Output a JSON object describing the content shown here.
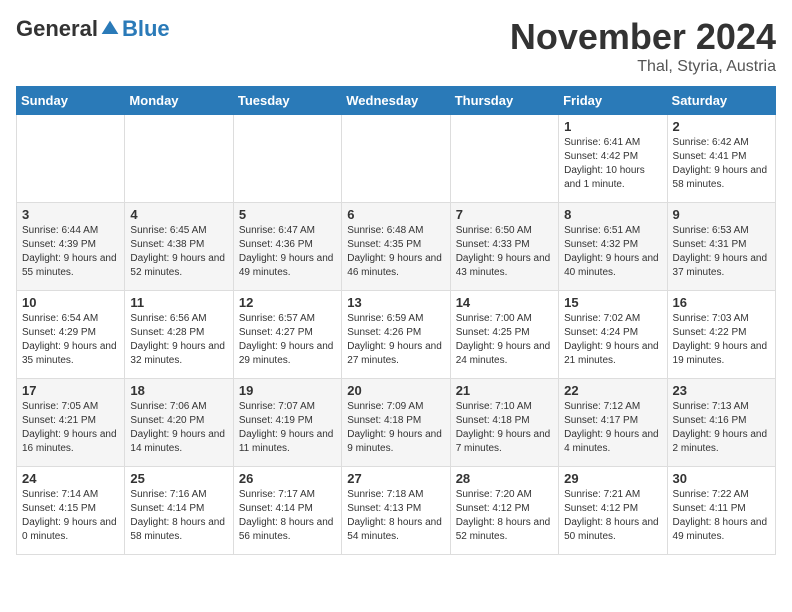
{
  "logo": {
    "general": "General",
    "blue": "Blue"
  },
  "header": {
    "month": "November 2024",
    "location": "Thal, Styria, Austria"
  },
  "weekdays": [
    "Sunday",
    "Monday",
    "Tuesday",
    "Wednesday",
    "Thursday",
    "Friday",
    "Saturday"
  ],
  "weeks": [
    [
      {
        "day": "",
        "info": ""
      },
      {
        "day": "",
        "info": ""
      },
      {
        "day": "",
        "info": ""
      },
      {
        "day": "",
        "info": ""
      },
      {
        "day": "",
        "info": ""
      },
      {
        "day": "1",
        "info": "Sunrise: 6:41 AM\nSunset: 4:42 PM\nDaylight: 10 hours and 1 minute."
      },
      {
        "day": "2",
        "info": "Sunrise: 6:42 AM\nSunset: 4:41 PM\nDaylight: 9 hours and 58 minutes."
      }
    ],
    [
      {
        "day": "3",
        "info": "Sunrise: 6:44 AM\nSunset: 4:39 PM\nDaylight: 9 hours and 55 minutes."
      },
      {
        "day": "4",
        "info": "Sunrise: 6:45 AM\nSunset: 4:38 PM\nDaylight: 9 hours and 52 minutes."
      },
      {
        "day": "5",
        "info": "Sunrise: 6:47 AM\nSunset: 4:36 PM\nDaylight: 9 hours and 49 minutes."
      },
      {
        "day": "6",
        "info": "Sunrise: 6:48 AM\nSunset: 4:35 PM\nDaylight: 9 hours and 46 minutes."
      },
      {
        "day": "7",
        "info": "Sunrise: 6:50 AM\nSunset: 4:33 PM\nDaylight: 9 hours and 43 minutes."
      },
      {
        "day": "8",
        "info": "Sunrise: 6:51 AM\nSunset: 4:32 PM\nDaylight: 9 hours and 40 minutes."
      },
      {
        "day": "9",
        "info": "Sunrise: 6:53 AM\nSunset: 4:31 PM\nDaylight: 9 hours and 37 minutes."
      }
    ],
    [
      {
        "day": "10",
        "info": "Sunrise: 6:54 AM\nSunset: 4:29 PM\nDaylight: 9 hours and 35 minutes."
      },
      {
        "day": "11",
        "info": "Sunrise: 6:56 AM\nSunset: 4:28 PM\nDaylight: 9 hours and 32 minutes."
      },
      {
        "day": "12",
        "info": "Sunrise: 6:57 AM\nSunset: 4:27 PM\nDaylight: 9 hours and 29 minutes."
      },
      {
        "day": "13",
        "info": "Sunrise: 6:59 AM\nSunset: 4:26 PM\nDaylight: 9 hours and 27 minutes."
      },
      {
        "day": "14",
        "info": "Sunrise: 7:00 AM\nSunset: 4:25 PM\nDaylight: 9 hours and 24 minutes."
      },
      {
        "day": "15",
        "info": "Sunrise: 7:02 AM\nSunset: 4:24 PM\nDaylight: 9 hours and 21 minutes."
      },
      {
        "day": "16",
        "info": "Sunrise: 7:03 AM\nSunset: 4:22 PM\nDaylight: 9 hours and 19 minutes."
      }
    ],
    [
      {
        "day": "17",
        "info": "Sunrise: 7:05 AM\nSunset: 4:21 PM\nDaylight: 9 hours and 16 minutes."
      },
      {
        "day": "18",
        "info": "Sunrise: 7:06 AM\nSunset: 4:20 PM\nDaylight: 9 hours and 14 minutes."
      },
      {
        "day": "19",
        "info": "Sunrise: 7:07 AM\nSunset: 4:19 PM\nDaylight: 9 hours and 11 minutes."
      },
      {
        "day": "20",
        "info": "Sunrise: 7:09 AM\nSunset: 4:18 PM\nDaylight: 9 hours and 9 minutes."
      },
      {
        "day": "21",
        "info": "Sunrise: 7:10 AM\nSunset: 4:18 PM\nDaylight: 9 hours and 7 minutes."
      },
      {
        "day": "22",
        "info": "Sunrise: 7:12 AM\nSunset: 4:17 PM\nDaylight: 9 hours and 4 minutes."
      },
      {
        "day": "23",
        "info": "Sunrise: 7:13 AM\nSunset: 4:16 PM\nDaylight: 9 hours and 2 minutes."
      }
    ],
    [
      {
        "day": "24",
        "info": "Sunrise: 7:14 AM\nSunset: 4:15 PM\nDaylight: 9 hours and 0 minutes."
      },
      {
        "day": "25",
        "info": "Sunrise: 7:16 AM\nSunset: 4:14 PM\nDaylight: 8 hours and 58 minutes."
      },
      {
        "day": "26",
        "info": "Sunrise: 7:17 AM\nSunset: 4:14 PM\nDaylight: 8 hours and 56 minutes."
      },
      {
        "day": "27",
        "info": "Sunrise: 7:18 AM\nSunset: 4:13 PM\nDaylight: 8 hours and 54 minutes."
      },
      {
        "day": "28",
        "info": "Sunrise: 7:20 AM\nSunset: 4:12 PM\nDaylight: 8 hours and 52 minutes."
      },
      {
        "day": "29",
        "info": "Sunrise: 7:21 AM\nSunset: 4:12 PM\nDaylight: 8 hours and 50 minutes."
      },
      {
        "day": "30",
        "info": "Sunrise: 7:22 AM\nSunset: 4:11 PM\nDaylight: 8 hours and 49 minutes."
      }
    ]
  ]
}
